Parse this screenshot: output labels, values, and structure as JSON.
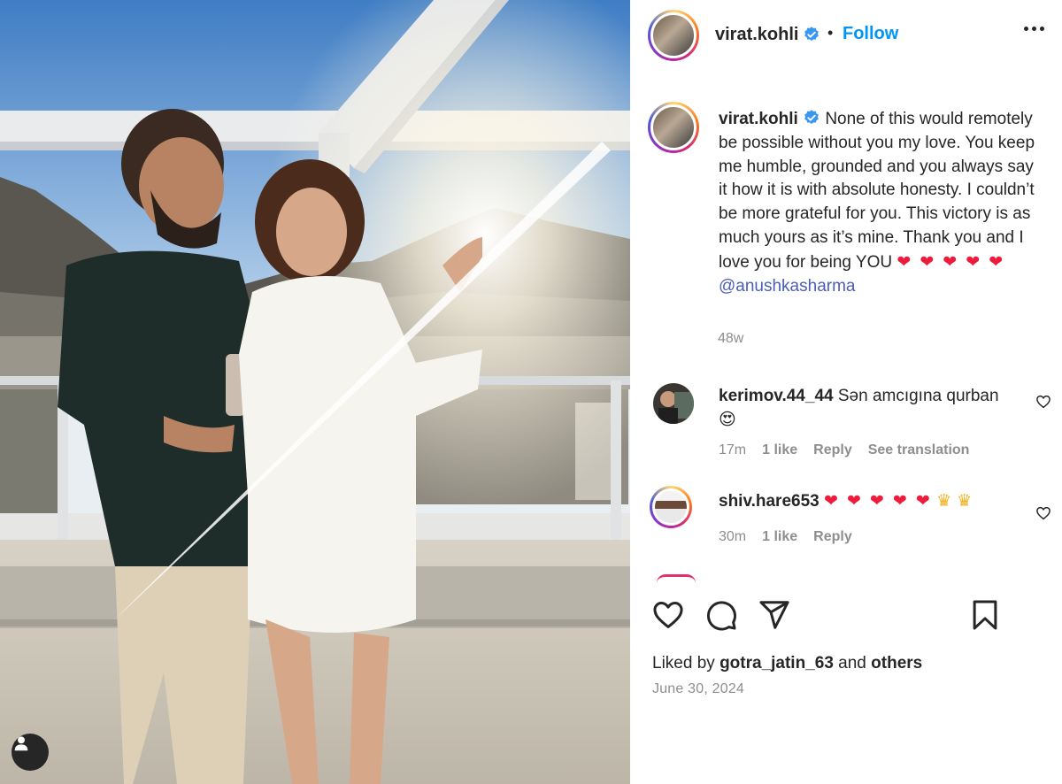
{
  "post": {
    "author": "virat.kohli",
    "follow_label": "Follow",
    "dot": "•",
    "caption_author": "virat.kohli",
    "caption": "None of this would remotely be possible without you my love. You keep me humble, grounded and you always say it how it is with absolute honesty. I couldn’t be more grateful for you. This victory is as much yours as it’s mine. Thank you and I love you for being YOU",
    "caption_emojis": "❤ ❤ ❤ ❤ ❤",
    "mention": "@anushkasharma",
    "caption_time": "48w",
    "liked_prefix": "Liked by",
    "liked_user": "gotra_jatin_63",
    "liked_and": "and",
    "liked_others": "others",
    "date": "June 30, 2024"
  },
  "comments": [
    {
      "user": "kerimov.44_44",
      "text": "Sən amcıgına qurban",
      "emoji": "😍",
      "time": "17m",
      "likes": "1 like",
      "reply": "Reply",
      "translate": "See translation"
    },
    {
      "user": "shiv.hare653",
      "hearts": "❤ ❤ ❤ ❤ ❤",
      "crowns": "♛ ♛",
      "time": "30m",
      "likes": "1 like",
      "reply": "Reply"
    }
  ],
  "icons": {
    "verified": "verified-badge-icon",
    "more": "more-options-icon",
    "like": "heart-icon",
    "comment": "comment-icon",
    "share": "share-icon",
    "save": "bookmark-icon",
    "tags": "user-tag-icon"
  },
  "colors": {
    "accent_blue": "#0095f6",
    "mention": "#4a5eb6",
    "text_primary": "#262626",
    "text_secondary": "#8e8e8e",
    "heart_red": "#ed1c3b"
  }
}
